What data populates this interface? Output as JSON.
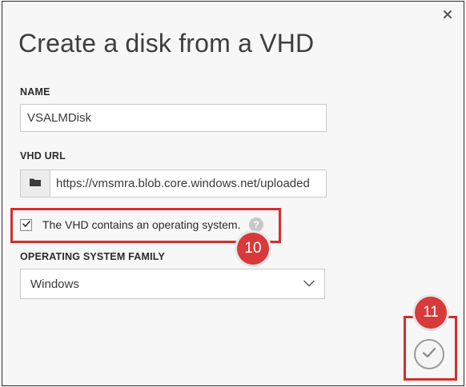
{
  "dialog": {
    "title": "Create a disk from a VHD"
  },
  "icons": {
    "close": "close-icon",
    "folder": "folder-icon",
    "check": "checkmark-icon",
    "help": "help-icon",
    "chevron": "chevron-down-icon",
    "confirm": "checkmark-circle-icon"
  },
  "form": {
    "name_label": "NAME",
    "name_value": "VSALMDisk",
    "vhd_url_label": "VHD URL",
    "vhd_url_value": "https://vmsmra.blob.core.windows.net/uploaded",
    "os_checkbox_label": "The VHD contains an operating system.",
    "os_checkbox_checked": true,
    "help_glyph": "?",
    "os_family_label": "OPERATING SYSTEM FAMILY",
    "os_family_value": "Windows"
  },
  "annotations": {
    "step_10": "10",
    "step_11": "11",
    "highlight_color": "#d0312d",
    "badge_color": "#d8393a"
  }
}
